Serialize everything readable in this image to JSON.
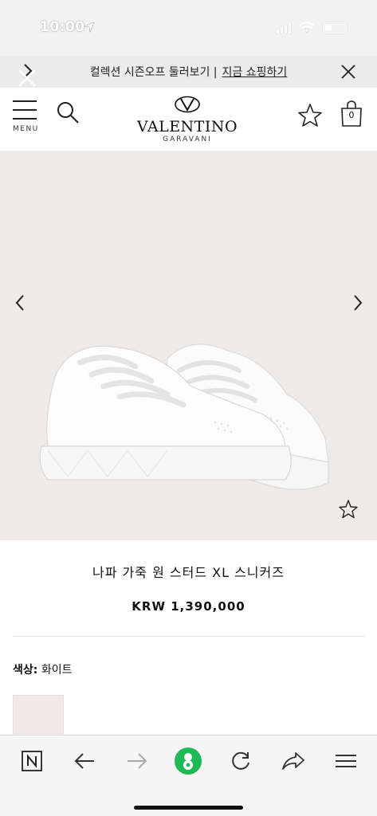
{
  "status_bar": {
    "time": "10:00"
  },
  "promo": {
    "text": "컬렉션 시즌오프 둘러보기 |",
    "link": "지금 쇼핑하기"
  },
  "header": {
    "menu_label": "MENU",
    "logo_name": "VALENTINO",
    "logo_sub": "GARAVANI",
    "bag_count": "0"
  },
  "product": {
    "name": "나파 가죽 원 스터드 XL 스니커즈",
    "price": "KRW 1,390,000",
    "color_label": "색상:",
    "color_value": "화이트"
  },
  "colors": {
    "accent_green": "#1db954",
    "hero_bg": "#eeeae7",
    "banner_bg": "#ebebeb"
  },
  "icons": [
    "navigation-arrow-icon",
    "signal-icon",
    "wifi-icon",
    "battery-icon",
    "chevron-right-icon",
    "close-icon",
    "menu-icon",
    "search-icon",
    "star-icon",
    "bag-icon",
    "chevron-left-icon",
    "n-logo-icon",
    "back-arrow-icon",
    "forward-arrow-icon",
    "naver-green-icon",
    "refresh-icon",
    "share-icon",
    "hamburger-icon"
  ]
}
